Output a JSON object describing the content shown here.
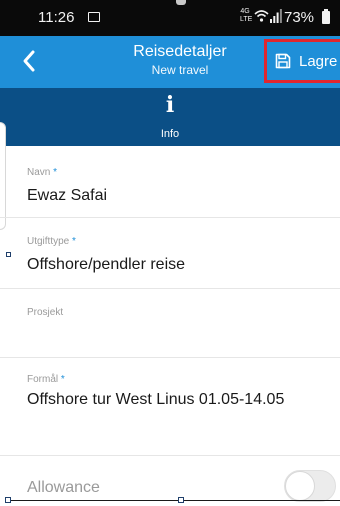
{
  "status_bar": {
    "time": "11:26",
    "network_type": "4G LTE",
    "battery": "73%"
  },
  "app_bar": {
    "title": "Reisedetaljer",
    "subtitle": "New travel",
    "save_label": "Lagre"
  },
  "tabs": {
    "info": {
      "label": "Info",
      "icon": "info-icon"
    }
  },
  "form": {
    "name": {
      "label": "Navn",
      "value": "Ewaz Safai",
      "required_mark": "*"
    },
    "expense_type": {
      "label": "Utgifttype",
      "value": "Offshore/pendler reise",
      "required_mark": "*"
    },
    "project": {
      "label": "Prosjekt",
      "value": ""
    },
    "purpose": {
      "label": "Formål",
      "value": "Offshore tur West Linus 01.05-14.05",
      "required_mark": "*"
    },
    "allowance": {
      "label": "Allowance",
      "enabled": false
    }
  },
  "colors": {
    "primary": "#1f8fd8",
    "tab_bar": "#0b4f86",
    "highlight": "#e0262f",
    "status_bar": "#0a0a0a"
  }
}
